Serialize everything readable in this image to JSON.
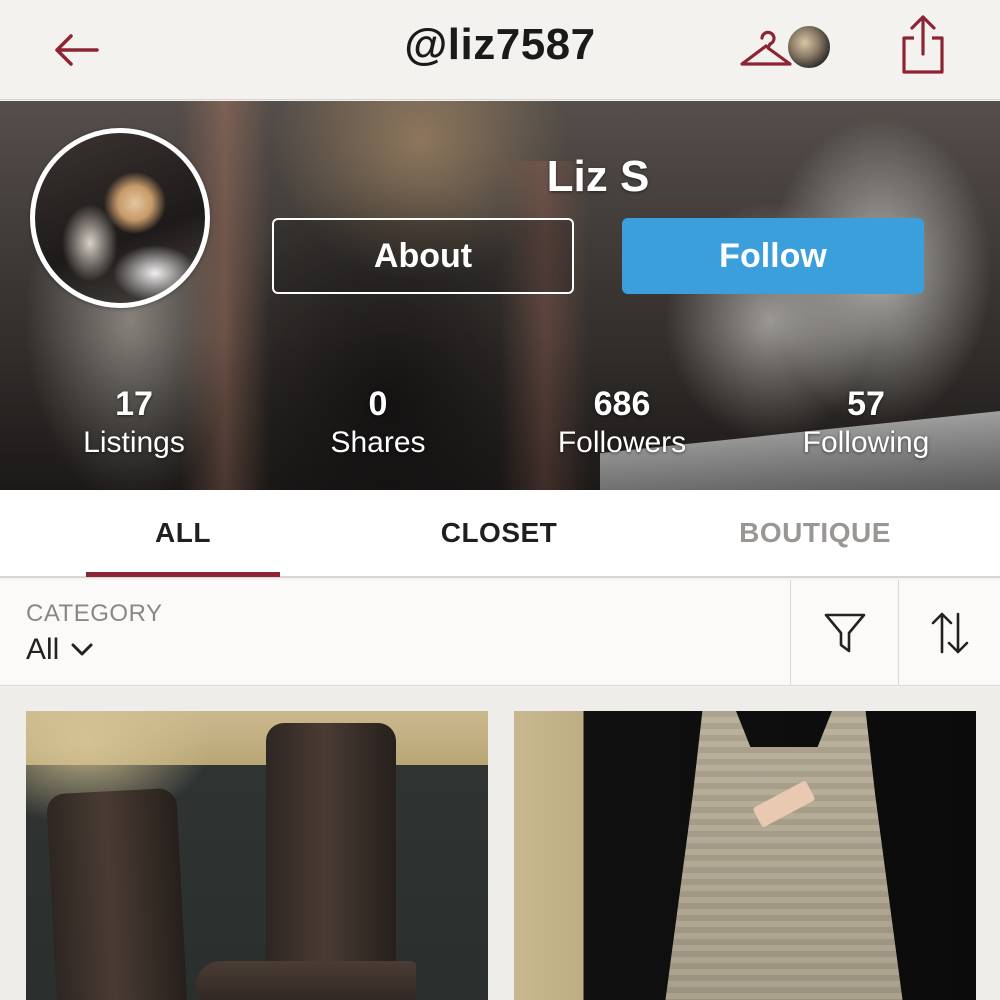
{
  "header": {
    "title": "@liz7587",
    "back_icon": "arrow-left-icon",
    "hanger_icon": "hanger-icon",
    "share_icon": "share-icon",
    "accent_color": "#8c2434"
  },
  "profile": {
    "name": "Liz S",
    "about_label": "About",
    "follow_label": "Follow",
    "follow_color": "#3b9fdc",
    "stats": [
      {
        "value": "17",
        "label": "Listings"
      },
      {
        "value": "0",
        "label": "Shares"
      },
      {
        "value": "686",
        "label": "Followers"
      },
      {
        "value": "57",
        "label": "Following"
      }
    ]
  },
  "tabs": [
    {
      "label": "ALL",
      "active": true
    },
    {
      "label": "CLOSET",
      "active": false
    },
    {
      "label": "BOUTIQUE",
      "active": false
    }
  ],
  "filter": {
    "category_label": "CATEGORY",
    "category_value": "All",
    "filter_icon": "filter-funnel-icon",
    "sort_icon": "sort-arrows-icon"
  },
  "listings": [
    {
      "image": "brown-leather-boots-photo"
    },
    {
      "image": "sequin-tank-top-photo"
    }
  ]
}
